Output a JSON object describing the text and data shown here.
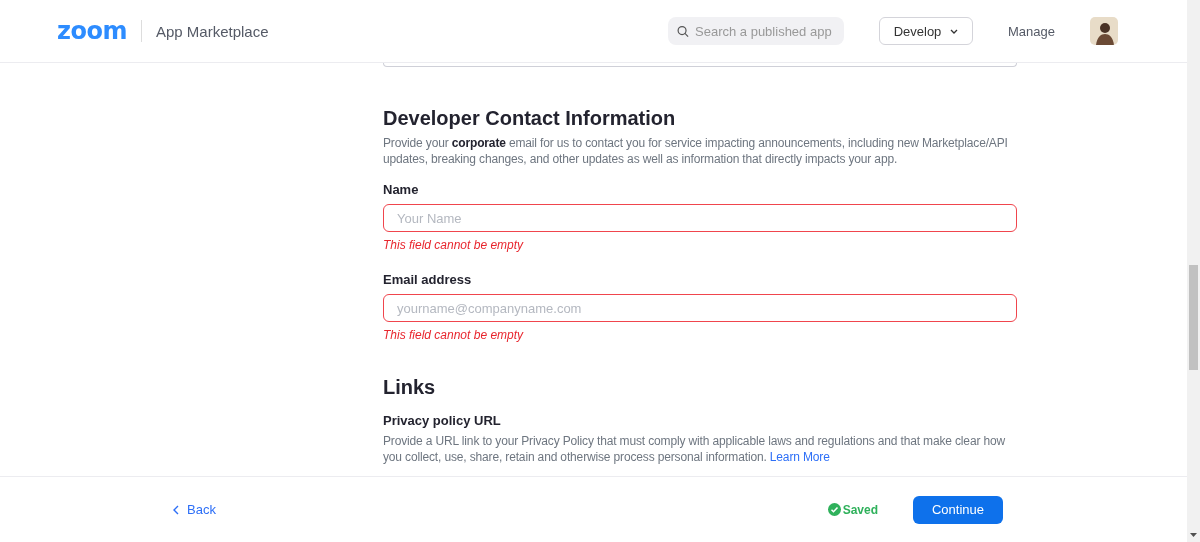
{
  "header": {
    "logo": "zoom",
    "title": "App Marketplace",
    "search": {
      "placeholder": "Search a published app"
    },
    "develop_menu": "Develop",
    "manage_link": "Manage"
  },
  "sections": [
    {
      "title": "Developer Contact Information",
      "description": "Provide your **corporate** email for us to contact you for service impacting announcements, including new Marketplace/API updates, breaking changes, and other updates as well as information that directly impacts your app.",
      "fields": [
        {
          "label": "Name",
          "placeholder": "Your Name",
          "error": "This field cannot be empty"
        },
        {
          "label": "Email address",
          "placeholder": "yourname@companyname.com",
          "error": "This field cannot be empty"
        }
      ]
    },
    {
      "title": "Links",
      "subsections": [
        {
          "label": "Privacy policy URL",
          "description": "Provide a URL link to your Privacy Policy that must comply with applicable laws and regulations and that make clear how you collect, use, share, retain and otherwise process personal information.",
          "link": "Learn More"
        }
      ]
    }
  ],
  "footer": {
    "back": "Back",
    "status": "Saved",
    "continue": "Continue"
  }
}
